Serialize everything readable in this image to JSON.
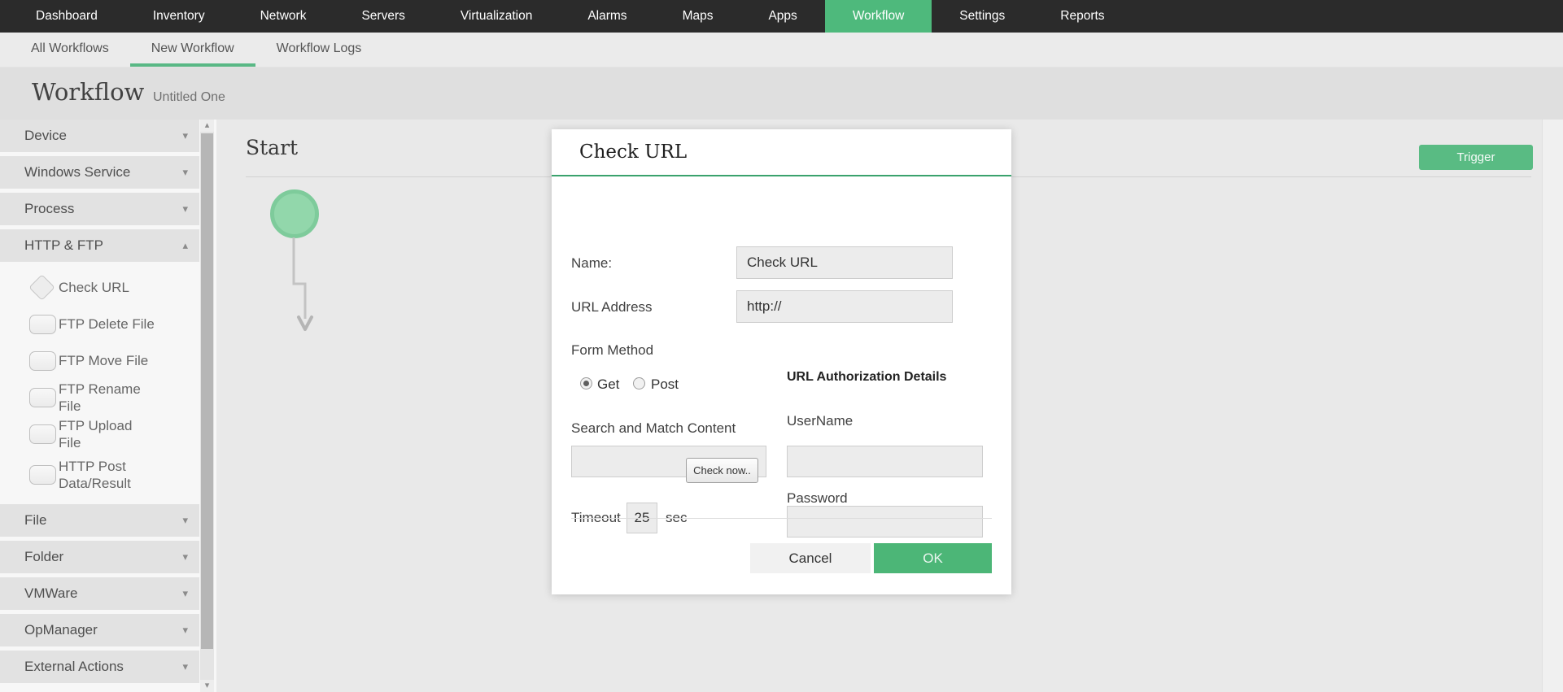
{
  "nav": {
    "items": [
      {
        "label": "Dashboard"
      },
      {
        "label": "Inventory"
      },
      {
        "label": "Network"
      },
      {
        "label": "Servers"
      },
      {
        "label": "Virtualization"
      },
      {
        "label": "Alarms"
      },
      {
        "label": "Maps"
      },
      {
        "label": "Apps"
      },
      {
        "label": "Workflow",
        "active": true
      },
      {
        "label": "Settings"
      },
      {
        "label": "Reports"
      }
    ]
  },
  "tabs": {
    "items": [
      {
        "label": "All Workflows"
      },
      {
        "label": "New Workflow",
        "active": true
      },
      {
        "label": "Workflow Logs"
      }
    ]
  },
  "header": {
    "title": "Workflow",
    "subtitle": "Untitled One"
  },
  "sidebar": {
    "sections": [
      {
        "label": "Device"
      },
      {
        "label": "Windows Service"
      },
      {
        "label": "Process"
      },
      {
        "label": "HTTP & FTP",
        "expanded": true,
        "items": [
          {
            "label": "Check URL",
            "icon": "diamond-icon"
          },
          {
            "label": "FTP Delete File",
            "icon": "rect-icon"
          },
          {
            "label": "FTP Move File",
            "icon": "rect-icon"
          },
          {
            "label": "FTP Rename File",
            "icon": "rect-icon"
          },
          {
            "label": "FTP Upload File",
            "icon": "rect-icon"
          },
          {
            "label": "HTTP Post Data/Result",
            "icon": "rect-icon"
          }
        ]
      },
      {
        "label": "File"
      },
      {
        "label": "Folder"
      },
      {
        "label": "VMWare"
      },
      {
        "label": "OpManager"
      },
      {
        "label": "External Actions"
      }
    ]
  },
  "canvas": {
    "start_label": "Start",
    "trigger_label": "Trigger"
  },
  "modal": {
    "title": "Check URL",
    "name_label": "Name:",
    "name_value": "Check URL",
    "url_label": "URL Address",
    "url_value": "http://",
    "form_method_label": "Form Method",
    "radio_get_label": "Get",
    "radio_post_label": "Post",
    "auth_header": "URL Authorization Details",
    "search_label": "Search and Match Content",
    "search_value": "",
    "username_label": "UserName",
    "username_value": "",
    "timeout_label": "Timeout",
    "timeout_value": "25",
    "timeout_unit": "sec",
    "check_now_label": "Check now..",
    "password_label": "Password",
    "password_value": "",
    "cancel_label": "Cancel",
    "ok_label": "OK"
  },
  "icons": {
    "chevron_down": "▾",
    "chevron_up": "▴"
  },
  "colors": {
    "accent_green": "#4eb97c",
    "title_rule_green": "#3aa26d",
    "nav_bg": "#2b2b2b"
  }
}
